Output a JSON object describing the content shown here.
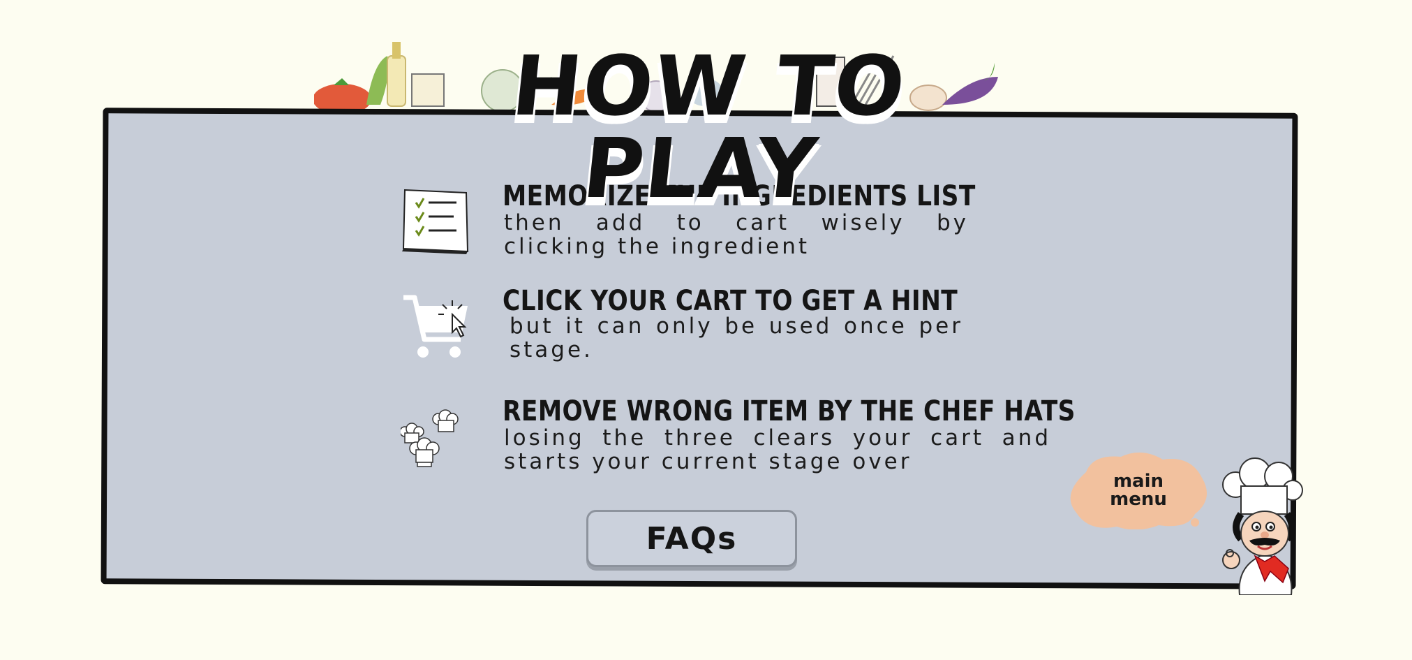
{
  "title": "HOW TO PLAY",
  "instructions": [
    {
      "icon": "checklist-icon",
      "heading": "MEMORIZE THE INGREDIENTS LIST",
      "description": "then add to cart wisely by clicking the ingredient"
    },
    {
      "icon": "cart-click-icon",
      "heading": "CLICK YOUR CART TO GET A HINT",
      "description": "but it can only be used once per stage."
    },
    {
      "icon": "chef-hats-icon",
      "heading": "REMOVE WRONG ITEM BY THE CHEF HATS",
      "description": "losing the three clears your cart and starts your current stage over"
    }
  ],
  "buttons": {
    "faq_label": "FAQs",
    "main_menu_label": "main\nmenu"
  },
  "colors": {
    "background": "#fdfdf1",
    "panel": "#c7cdd8",
    "border": "#111111",
    "menu_blob": "#f2c19e"
  }
}
